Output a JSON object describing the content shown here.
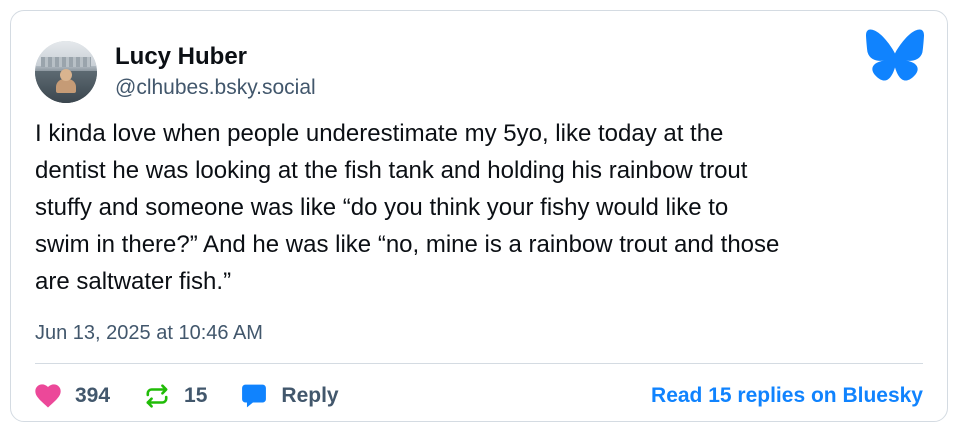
{
  "author": {
    "display_name": "Lucy Huber",
    "handle": "@clhubes.bsky.social"
  },
  "post": {
    "text": "I kinda love when people underestimate my 5yo, like today at the\ndentist he was looking at the fish tank and holding his rainbow trout\nstuffy and someone was like “do you think your fishy would like to\nswim in there?” And he was like “no, mine is a rainbow trout and those\nare saltwater fish.”",
    "timestamp": "Jun 13, 2025 at 10:46 AM"
  },
  "stats": {
    "likes": "394",
    "reposts": "15",
    "reply_label": "Reply"
  },
  "read_replies_link": "Read 15 replies on Bluesky",
  "icons": {
    "brand": "butterfly-icon",
    "like": "heart-icon",
    "repost": "repost-icon",
    "reply": "speech-bubble-icon"
  },
  "colors": {
    "brand_blue": "#1083fe",
    "like_pink": "#ec4899",
    "repost_green": "#20bc07",
    "reply_blue": "#1083fe",
    "muted_text": "#42576c"
  }
}
